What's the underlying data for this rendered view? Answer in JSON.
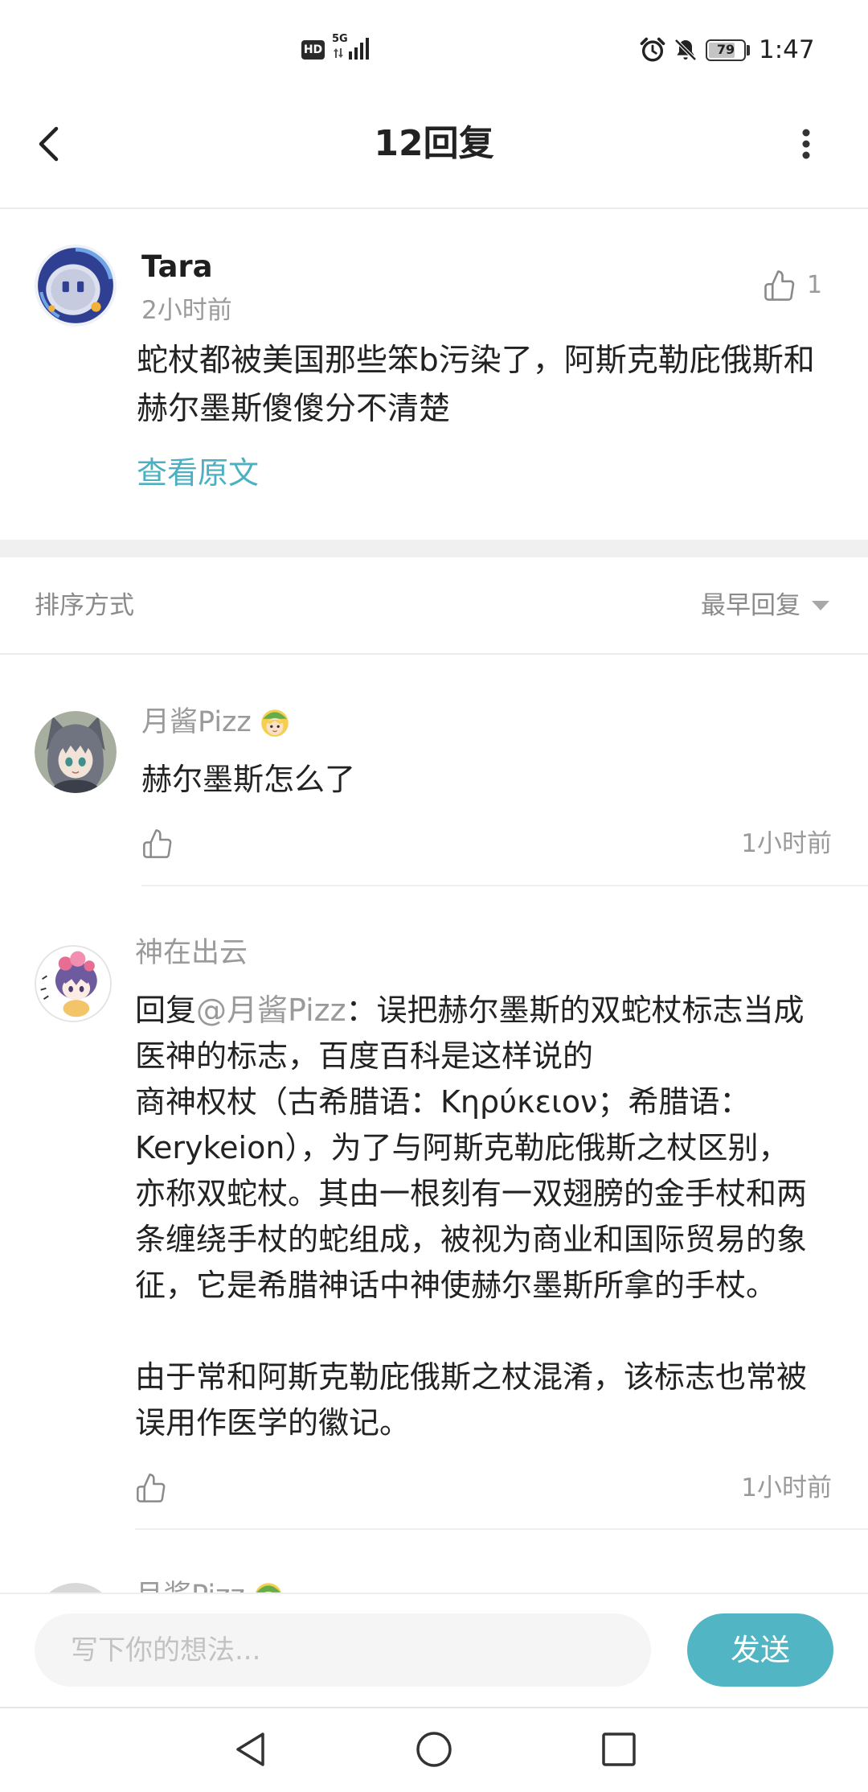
{
  "status_bar": {
    "hd_label": "HD",
    "network_label": "5G",
    "battery_level": "79",
    "time": "1:47"
  },
  "header": {
    "title": "12回复"
  },
  "post": {
    "author": "Tara",
    "time": "2小时前",
    "like_count": "1",
    "lines": [
      "蛇杖都被美国那些笨b污染了，阿斯克勒庇俄斯和",
      "赫尔墨斯傻傻分不清楚"
    ],
    "view_original_label": "查看原文"
  },
  "sort": {
    "label": "排序方式",
    "selected": "最早回复"
  },
  "comments": [
    {
      "author": "月酱Pizz",
      "lines": [
        "赫尔墨斯怎么了"
      ],
      "time": "1小时前"
    },
    {
      "author": "神在出云",
      "reply_prefix": "回复",
      "reply_to": "@月酱Pizz",
      "first_line": "：误把赫尔墨斯的双蛇杖标志当成",
      "lines": [
        "医神的标志，百度百科是这样说的",
        "商神权杖（古希腊语：Κηρύκειον；希腊语：",
        "Kerykeion），为了与阿斯克勒庇俄斯之杖区别，",
        "亦称双蛇杖。其由一根刻有一双翅膀的金手杖和两",
        "条缠绕手杖的蛇组成，被视为商业和国际贸易的象",
        "征，它是希腊神话中神使赫尔墨斯所拿的手杖。"
      ],
      "paragraph2_lines": [
        "由于常和阿斯克勒庇俄斯之杖混淆，该标志也常被",
        "误用作医学的徽记。"
      ],
      "time": "1小时前"
    },
    {
      "author": "月酱Pizz"
    }
  ],
  "composer": {
    "placeholder": "写下你的想法...",
    "send_label": "发送"
  },
  "icons": {
    "back": "back-arrow-icon",
    "more": "more-vertical-icon",
    "like": "thumbs-up-icon",
    "sort_dropdown": "triangle-down-icon",
    "alarm": "alarm-clock-icon",
    "mute": "bell-off-icon",
    "signal": "signal-bars-icon",
    "battery": "battery-icon",
    "user_badge": "badge-icon",
    "nav_back": "nav-back-icon",
    "nav_home": "nav-home-icon",
    "nav_recents": "nav-recents-icon"
  },
  "colors": {
    "accent": "#4ab0c2",
    "send_button": "#52b5c4",
    "muted_text": "#9a9a9a",
    "primary_text": "#222222"
  }
}
